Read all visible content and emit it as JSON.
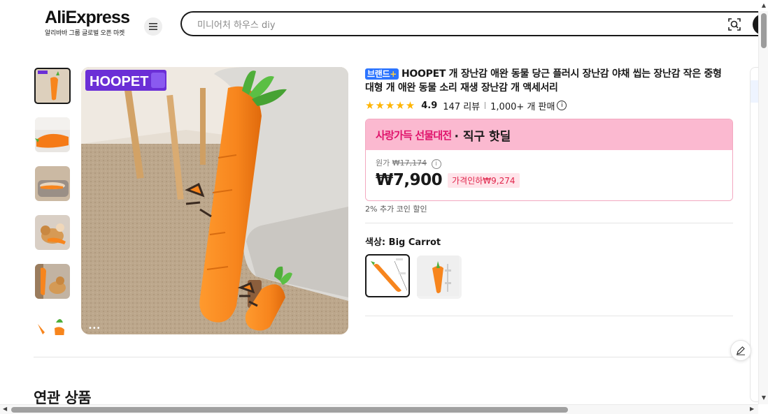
{
  "header": {
    "logo_title": "AliExpress",
    "logo_subtitle": "알리바바 그룹 글로벌 오픈 마켓",
    "search_placeholder": "미니어처 하우스 diy"
  },
  "product": {
    "brand_badge": "브랜드",
    "brand_plus": "+",
    "title": "HOOPET 개 장난감 애완 동물 당근 플러시 장난감 야채 씹는 장난감 작은 중형 대형 개 애완 동물 소리 재생 장난감 개 액세서리",
    "rating": "4.9",
    "rating_value": 4.9,
    "stars": "★★★★★",
    "reviews": "147 리뷰",
    "sold": "1,000+ 개 판매",
    "info_glyph": "i",
    "image_logo": "HOOPET"
  },
  "deal": {
    "banner_pink": "사랑가득 선물대전",
    "banner_dark": "· 직구 핫딜",
    "original_label": "원가",
    "original_price": "₩17,174",
    "price": "₩7,900",
    "discount": "가격인하₩9,274",
    "coin_note": "2% 추가 코인 할인"
  },
  "variant": {
    "label_prefix": "색상:",
    "label_value": "Big Carrot",
    "options": [
      "Big Carrot",
      "Small Carrot"
    ],
    "selected_index": 0
  },
  "thumbnails": {
    "count_visible": 6,
    "selected_index": 0
  },
  "gallery": {
    "dots": "•••"
  },
  "related": {
    "heading": "연관 상품"
  },
  "colors": {
    "accent": "#191919",
    "brand_badge": "#2b74ff",
    "deal_banner": "#fbb9d0",
    "deal_text": "#e0146c",
    "discount_text": "#e0244a",
    "star": "#ffb400",
    "carrot": "#f7851d",
    "leaf": "#4fae3a"
  },
  "icons": {
    "menu": "menu-icon",
    "search_lens": "image-search-icon",
    "info": "info-icon",
    "edit": "pencil-icon"
  }
}
